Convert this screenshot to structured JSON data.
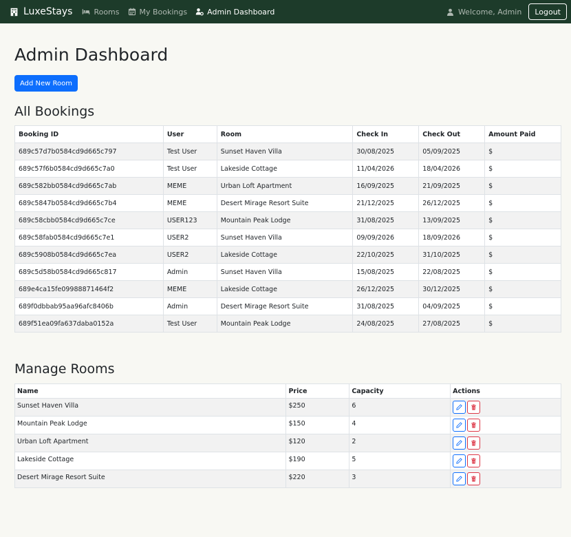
{
  "nav": {
    "brand": "LuxeStays",
    "links": [
      {
        "label": "Rooms",
        "icon": "bed-icon"
      },
      {
        "label": "My Bookings",
        "icon": "calendar-icon"
      },
      {
        "label": "Admin Dashboard",
        "icon": "user-gear-icon"
      }
    ],
    "welcome": "Welcome, Admin",
    "logout": "Logout"
  },
  "page": {
    "title": "Admin Dashboard",
    "add_room": "Add New Room"
  },
  "bookings": {
    "heading": "All Bookings",
    "columns": [
      "Booking ID",
      "User",
      "Room",
      "Check In",
      "Check Out",
      "Amount Paid"
    ],
    "rows": [
      [
        "689c57d7b0584cd9d665c797",
        "Test User",
        "Sunset Haven Villa",
        "30/08/2025",
        "05/09/2025",
        "$"
      ],
      [
        "689c57f6b0584cd9d665c7a0",
        "Test User",
        "Lakeside Cottage",
        "11/04/2026",
        "18/04/2026",
        "$"
      ],
      [
        "689c582bb0584cd9d665c7ab",
        "MEME",
        "Urban Loft Apartment",
        "16/09/2025",
        "21/09/2025",
        "$"
      ],
      [
        "689c5847b0584cd9d665c7b4",
        "MEME",
        "Desert Mirage Resort Suite",
        "21/12/2025",
        "26/12/2025",
        "$"
      ],
      [
        "689c58cbb0584cd9d665c7ce",
        "USER123",
        "Mountain Peak Lodge",
        "31/08/2025",
        "13/09/2025",
        "$"
      ],
      [
        "689c58fab0584cd9d665c7e1",
        "USER2",
        "Sunset Haven Villa",
        "09/09/2026",
        "18/09/2026",
        "$"
      ],
      [
        "689c5908b0584cd9d665c7ea",
        "USER2",
        "Lakeside Cottage",
        "22/10/2025",
        "31/10/2025",
        "$"
      ],
      [
        "689c5d58b0584cd9d665c817",
        "Admin",
        "Sunset Haven Villa",
        "15/08/2025",
        "22/08/2025",
        "$"
      ],
      [
        "689e4ca15fe09988871464f2",
        "MEME",
        "Lakeside Cottage",
        "26/12/2025",
        "30/12/2025",
        "$"
      ],
      [
        "689f0dbbab95aa96afc8406b",
        "Admin",
        "Desert Mirage Resort Suite",
        "31/08/2025",
        "04/09/2025",
        "$"
      ],
      [
        "689f51ea09fa637daba0152a",
        "Test User",
        "Mountain Peak Lodge",
        "24/08/2025",
        "27/08/2025",
        "$"
      ]
    ]
  },
  "rooms": {
    "heading": "Manage Rooms",
    "columns": [
      "Name",
      "Price",
      "Capacity",
      "Actions"
    ],
    "rows": [
      [
        "Sunset Haven Villa",
        "$250",
        "6"
      ],
      [
        "Mountain Peak Lodge",
        "$150",
        "4"
      ],
      [
        "Urban Loft Apartment",
        "$120",
        "2"
      ],
      [
        "Lakeside Cottage",
        "$190",
        "5"
      ],
      [
        "Desert Mirage Resort Suite",
        "$220",
        "3"
      ]
    ]
  },
  "colors": {
    "navbar": "#1d3b2a",
    "primary": "#0d6efd",
    "danger": "#dc3545",
    "background": "#f8f8f3"
  }
}
